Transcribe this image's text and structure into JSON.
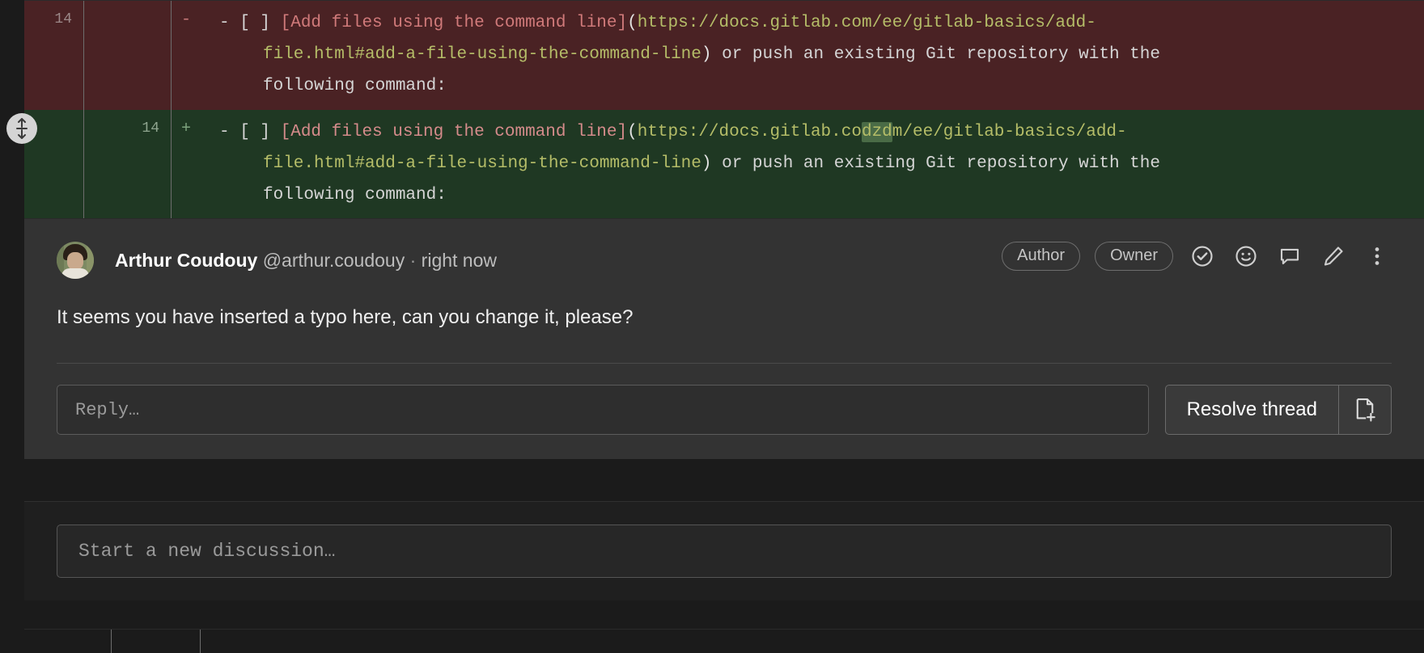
{
  "diff": {
    "rows": [
      {
        "type": "removed",
        "old_line": "14",
        "new_line": "",
        "sign": "-",
        "line1_prefix": "- [ ] ",
        "line1_linktext": "[Add files using the command line]",
        "line1_open": "(",
        "line1_url": "https://docs.gitlab.com/ee/gitlab-basics/add-",
        "line2_url": "file.html#add-a-file-using-the-command-line",
        "line2_close": ")",
        "line2_rest": " or push an existing Git repository with the",
        "line3": "following command:"
      },
      {
        "type": "added",
        "old_line": "",
        "new_line": "14",
        "sign": "+",
        "line1_prefix": "- [ ] ",
        "line1_linktext": "[Add files using the command line]",
        "line1_open": "(",
        "line1_url_a": "https://docs.gitlab.co",
        "line1_url_hl": "dzd",
        "line1_url_b": "m/ee/gitlab-basics/add-",
        "line2_url": "file.html#add-a-file-using-the-command-line",
        "line2_close": ")",
        "line2_rest": " or push an existing Git repository with the",
        "line3": "following command:"
      }
    ],
    "expand_handle_name": "expand-collapse-handle"
  },
  "comment": {
    "author_name": "Arthur Coudouy",
    "author_handle": "@arthur.coudouy",
    "separator": "·",
    "timestamp": "right now",
    "badges": [
      "Author",
      "Owner"
    ],
    "actions": [
      {
        "name": "resolve-thread-icon",
        "title": "Resolve thread"
      },
      {
        "name": "emoji-reaction-icon",
        "title": "Add reaction"
      },
      {
        "name": "reply-comment-icon",
        "title": "Reply"
      },
      {
        "name": "edit-comment-icon",
        "title": "Edit comment"
      },
      {
        "name": "more-actions-icon",
        "title": "More actions"
      }
    ],
    "body": "It seems you have inserted a typo here, can you change it, please?"
  },
  "reply": {
    "placeholder": "Reply…",
    "value": "",
    "resolve_label": "Resolve thread",
    "new_issue_icon": "new-issue-icon"
  },
  "new_discussion": {
    "placeholder": "Start a new discussion…",
    "value": ""
  },
  "colors": {
    "removed_bg": "#4a2224",
    "added_bg": "#1f3823",
    "word_highlight": "#4a6b46",
    "comment_bg": "#333333",
    "page_bg": "#1b1b1b",
    "link_token": "#d07a7a",
    "url_token": "#b5bd68"
  }
}
